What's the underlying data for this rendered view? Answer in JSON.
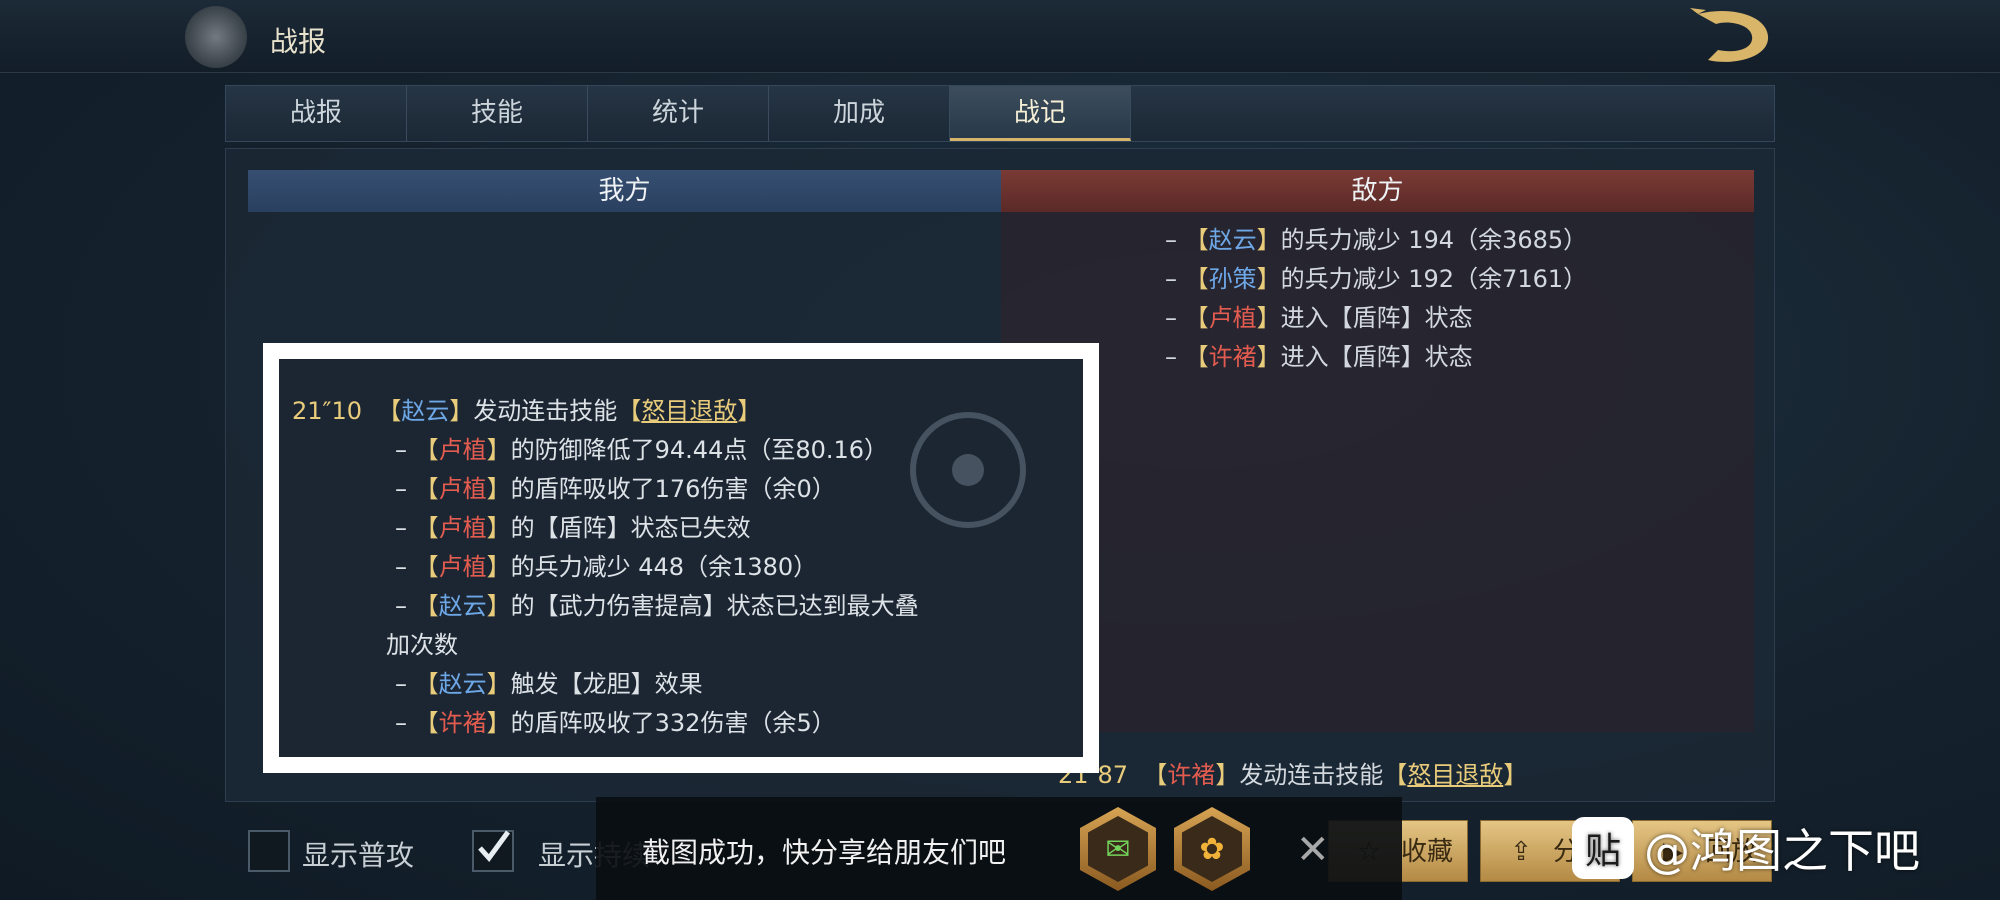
{
  "header": {
    "title": "战报"
  },
  "tabs": [
    {
      "label": "战报"
    },
    {
      "label": "技能"
    },
    {
      "label": "统计"
    },
    {
      "label": "加成"
    },
    {
      "label": "战记",
      "active": true
    }
  ],
  "columns": {
    "ours": "我方",
    "enemy": "敌方"
  },
  "enemy_log": [
    {
      "dash": "–",
      "open": "【",
      "name": "赵云",
      "close": "】",
      "text": "的兵力减少 194（余3685）"
    },
    {
      "dash": "–",
      "open": "【",
      "name": "孙策",
      "close": "】",
      "text": "的兵力减少 192（余7161）"
    },
    {
      "dash": "–",
      "open": "【",
      "name": "卢植",
      "close": "】",
      "text": "进入【盾阵】状态"
    },
    {
      "dash": "–",
      "open": "【",
      "name": "许褚",
      "close": "】",
      "text": "进入【盾阵】状态"
    }
  ],
  "highlight": {
    "time": "21″10",
    "actor": "赵云",
    "action": "发动连击技能",
    "skill": "怒目退敌",
    "lines": [
      {
        "name": "卢植",
        "text": "的防御降低了94.44点（至80.16）"
      },
      {
        "name": "卢植",
        "text": "的盾阵吸收了176伤害（余0）"
      },
      {
        "name": "卢植",
        "text": "的【盾阵】状态已失效"
      },
      {
        "name": "卢植",
        "text": "的兵力减少 448（余1380）"
      },
      {
        "name": "赵云",
        "text": "的【武力伤害提高】状态已达到最大叠"
      },
      {
        "name": "赵云",
        "text": "触发【龙胆】效果"
      },
      {
        "name": "许褚",
        "text": "的盾阵吸收了332伤害（余5）"
      }
    ],
    "wrap_text": "加次数"
  },
  "enemy_next": {
    "time": "21″87",
    "name": "许褚",
    "action": "发动连击技能",
    "skill": "怒目退敌"
  },
  "checkboxes": [
    {
      "label": "显示普攻",
      "checked": false
    },
    {
      "label": "显示持续",
      "checked": true
    }
  ],
  "toast": {
    "message": "截图成功，快分享给朋友们吧",
    "close": "✕"
  },
  "share_icons": [
    "wechat-icon",
    "moments-icon"
  ],
  "actions": {
    "collect": "收藏",
    "share": "分享",
    "replay": "回放"
  },
  "watermark": {
    "logo": "贴",
    "text": "@鸿图之下吧"
  },
  "colors": {
    "ally_name": "#6ea7e6",
    "enemy_name": "#e35c4f",
    "skill": "#e9cc7b",
    "accent": "#d6b46a"
  }
}
